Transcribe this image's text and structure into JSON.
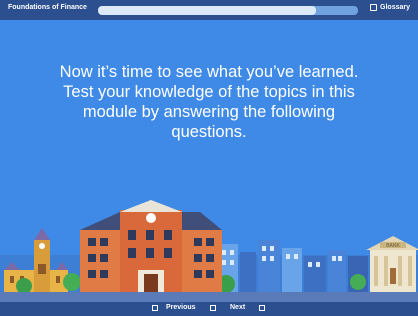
{
  "header": {
    "course_title": "Foundations of Finance",
    "progress_fraction": 0.84,
    "glossary_label": "Glossary",
    "glossary_icon": "book-icon"
  },
  "main": {
    "message": "Now it’s time to see what you’ve learned. Test your knowledge of the topics in this module by answering the following questions.",
    "illustration": {
      "bank_sign": "BANK"
    }
  },
  "footer": {
    "previous_label": "Previous",
    "next_label": "Next"
  },
  "colors": {
    "bar": "#2b4f8f",
    "stage": "#3f8ae6",
    "progress_fill": "#dbe9f9",
    "progress_track": "#6fa2df"
  }
}
